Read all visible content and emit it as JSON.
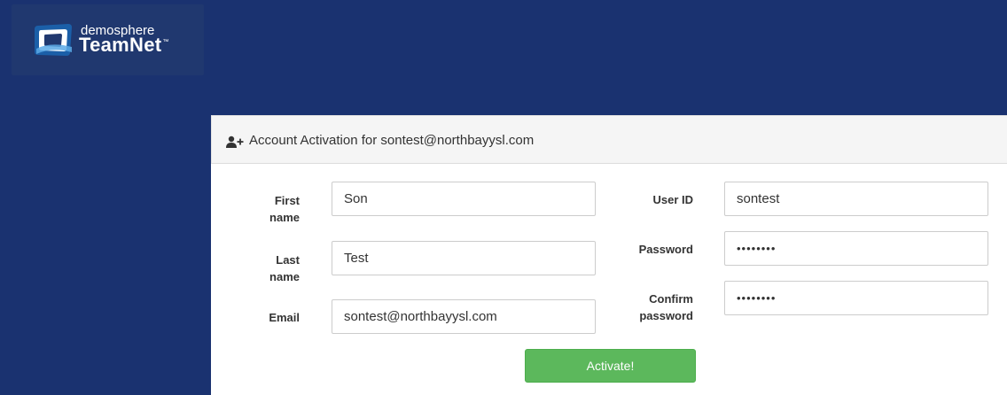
{
  "logo": {
    "small_text": "demosphere",
    "big_text": "TeamNet",
    "tm": "™"
  },
  "header": {
    "icon": "user-plus-icon",
    "title": "Account Activation for sontest@northbayysl.com"
  },
  "form": {
    "first_name": {
      "label": "First name",
      "value": "Son"
    },
    "last_name": {
      "label": "Last name",
      "value": "Test"
    },
    "email": {
      "label": "Email",
      "value": "sontest@northbayysl.com"
    },
    "user_id": {
      "label": "User ID",
      "value": "sontest"
    },
    "password": {
      "label": "Password",
      "value": "••••••••"
    },
    "confirm_password": {
      "label": "Confirm password",
      "value": "••••••••"
    }
  },
  "activate_label": "Activate!",
  "colors": {
    "background": "#1a3270",
    "logo_box": "#20386f",
    "button": "#5cb85c"
  }
}
